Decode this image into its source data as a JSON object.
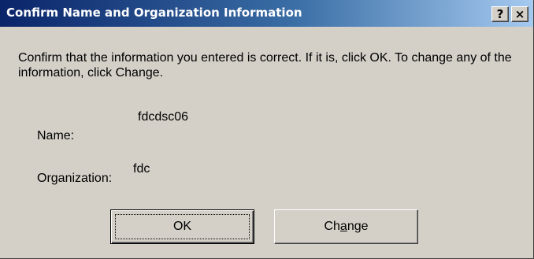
{
  "dialog": {
    "title": "Confirm Name and Organization Information",
    "help_label": "?",
    "close_label": "×",
    "message": "Confirm that the information you entered is correct. If it is, click OK. To change any of the information, click Change."
  },
  "fields": {
    "name_label": "Name:",
    "name_value": "fdcdsc06",
    "organization_label": "Organization:",
    "organization_value": "fdc"
  },
  "buttons": {
    "ok_label": "OK",
    "change_label_before": "Ch",
    "change_label_mnemonic": "a",
    "change_label_after": "nge"
  },
  "colors": {
    "titlebar_start": "#0a246a",
    "titlebar_end": "#a6caf0",
    "dialog_face": "#d4d0c8"
  }
}
